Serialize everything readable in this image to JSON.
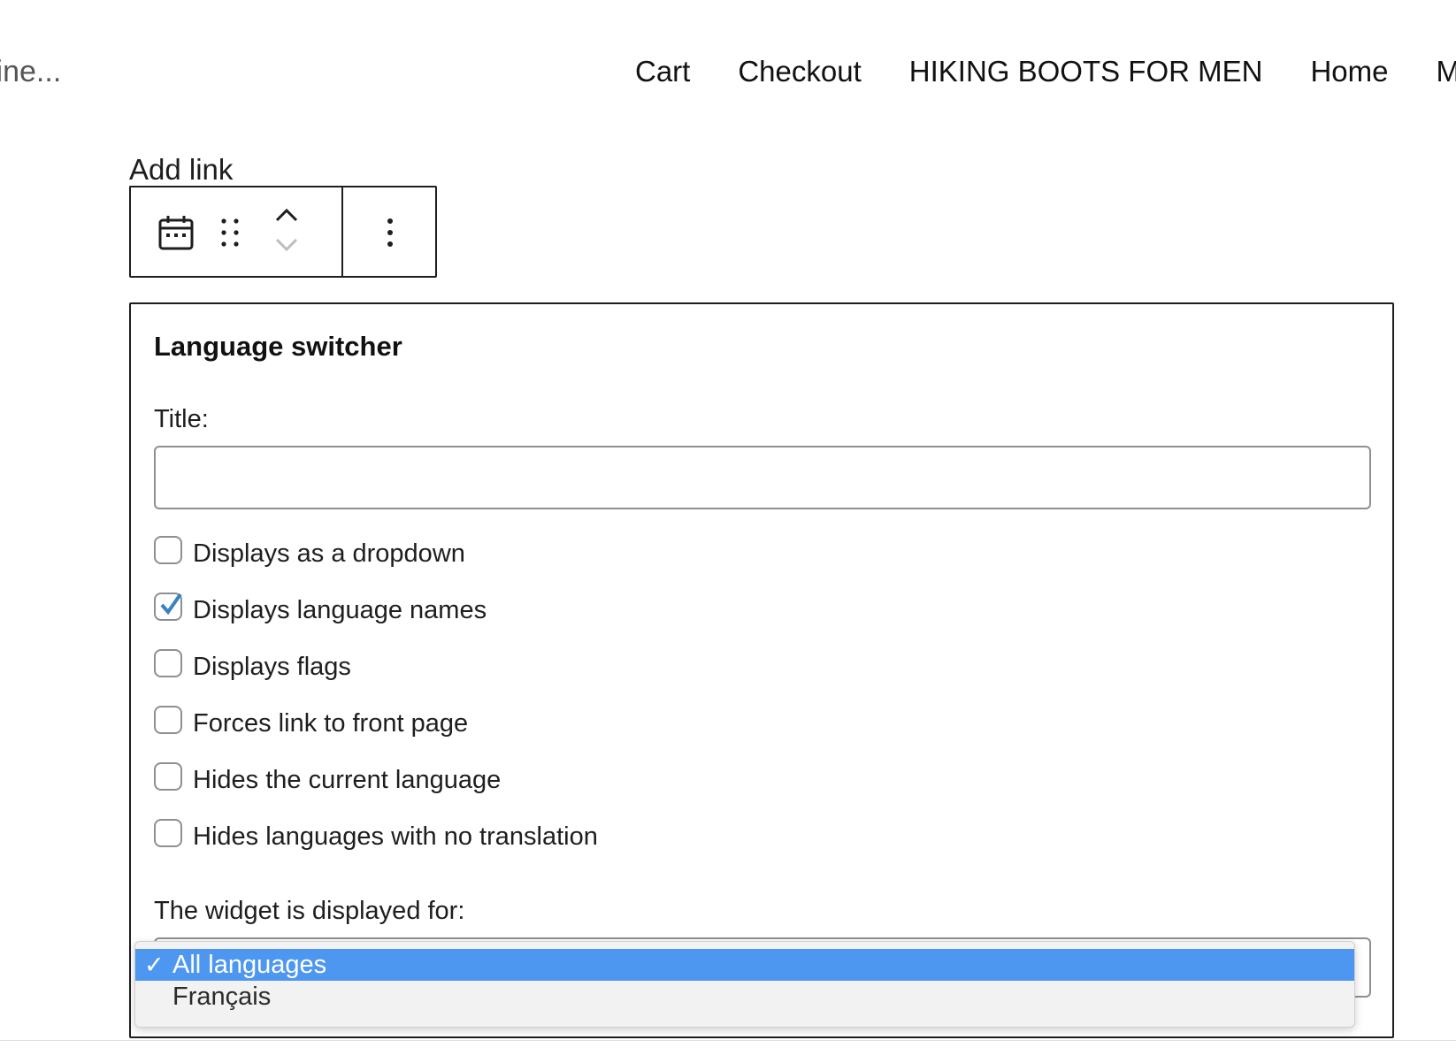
{
  "header": {
    "tagline_fragment": "line...",
    "nav": [
      "Cart",
      "Checkout",
      "HIKING BOOTS FOR MEN",
      "Home",
      "M"
    ]
  },
  "editor": {
    "add_link": "Add link",
    "toolbar": {
      "icons": [
        "calendar-icon",
        "drag-handle-icon",
        "move-up-icon",
        "move-down-icon",
        "more-options-icon"
      ]
    }
  },
  "widget": {
    "title": "Language switcher",
    "title_label": "Title:",
    "title_value": "",
    "options": [
      {
        "label": "Displays as a dropdown",
        "checked": false
      },
      {
        "label": "Displays language names",
        "checked": true
      },
      {
        "label": "Displays flags",
        "checked": false
      },
      {
        "label": "Forces link to front page",
        "checked": false
      },
      {
        "label": "Hides the current language",
        "checked": false
      },
      {
        "label": "Hides languages with no translation",
        "checked": false
      }
    ],
    "displayed_for_label": "The widget is displayed for:",
    "dropdown": {
      "selected": "All languages",
      "items": [
        "All languages",
        "Français"
      ]
    }
  },
  "colors": {
    "check_accent": "#3582c4",
    "option_highlight": "#4e97f0"
  }
}
